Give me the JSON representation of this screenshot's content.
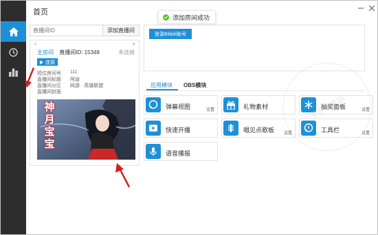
{
  "header": {
    "title": "首页"
  },
  "toast": {
    "message": "添加房间成功"
  },
  "search": {
    "placeholder": "直播间ID",
    "add_label": "添加直播间"
  },
  "room": {
    "main_label": "主房间",
    "room_id_text": "直播间ID: 15348",
    "status": "未连接",
    "connect_label": "连接",
    "fields": [
      {
        "label": "短位房间号",
        "value": "111"
      },
      {
        "label": "直播间标题",
        "value": "阿迪"
      },
      {
        "label": "直播间分区",
        "value": "网游 · 英雄联盟"
      },
      {
        "label": "直播间封面",
        "value": ""
      }
    ],
    "cover_text": [
      "神",
      "月",
      "宝",
      "宝"
    ]
  },
  "login": {
    "button_label": "登录Bilibili账号"
  },
  "tabs": [
    {
      "label": "应用模块",
      "active": true
    },
    {
      "label": "OBS模块",
      "active": false
    }
  ],
  "modules": [
    {
      "label": "弹幕视图",
      "settings": "设置",
      "icon": "chat-icon"
    },
    {
      "label": "礼物素材",
      "settings": "",
      "icon": "gift-icon"
    },
    {
      "label": "抽奖面板",
      "settings": "设置",
      "icon": "snowflake-icon"
    },
    {
      "label": "快速开播",
      "settings": "",
      "icon": "play-icon"
    },
    {
      "label": "唱见点歌板",
      "settings": "设置",
      "icon": "music-icon"
    },
    {
      "label": "工具栏",
      "settings": "设置",
      "icon": "tool-icon"
    },
    {
      "label": "语音播报",
      "settings": "",
      "icon": "mic-icon"
    }
  ],
  "watermark": {
    "text": "多多软件站"
  },
  "colors": {
    "accent": "#1e90d8",
    "sidebar": "#2d2d2d",
    "success": "#52c41a",
    "arrow": "#d22020"
  }
}
